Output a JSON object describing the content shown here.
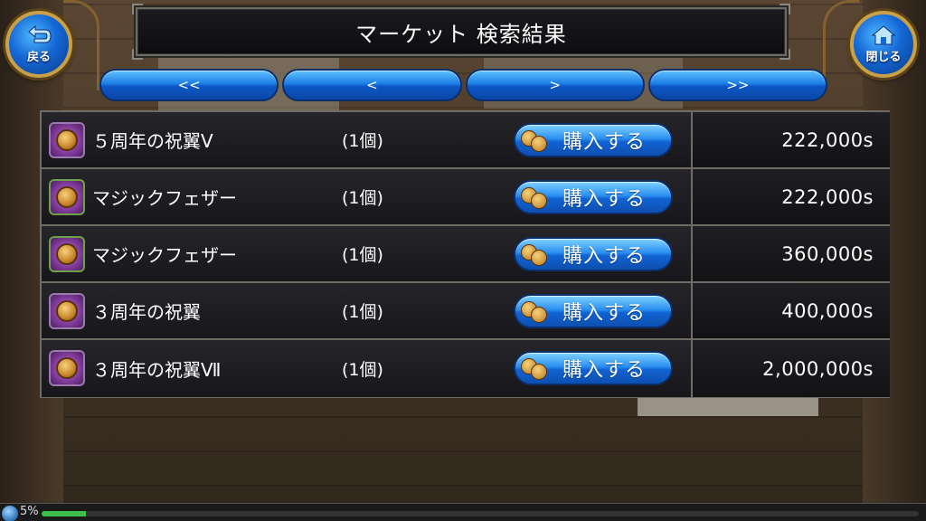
{
  "header": {
    "title": "マーケット 検索結果",
    "back_label": "戻る",
    "close_label": "閉じる"
  },
  "pager": {
    "first": "<<",
    "prev": "<",
    "next": ">",
    "last": ">>"
  },
  "items": [
    {
      "name": "５周年の祝翼Ⅴ",
      "qty": "(1個)",
      "buy_label": "購入する",
      "price": "222,000s"
    },
    {
      "name": "マジックフェザー",
      "qty": "(1個)",
      "buy_label": "購入する",
      "price": "222,000s"
    },
    {
      "name": "マジックフェザー",
      "qty": "(1個)",
      "buy_label": "購入する",
      "price": "360,000s"
    },
    {
      "name": "３周年の祝翼",
      "qty": "(1個)",
      "buy_label": "購入する",
      "price": "400,000s"
    },
    {
      "name": "３周年の祝翼Ⅶ",
      "qty": "(1個)",
      "buy_label": "購入する",
      "price": "2,000,000s"
    }
  ],
  "footer": {
    "percent_label": "5%",
    "progress": 0.05
  },
  "colors": {
    "button_blue": "#1d7fe6",
    "gold_border": "#c9a04a",
    "progress_green": "#3fbf4a"
  }
}
